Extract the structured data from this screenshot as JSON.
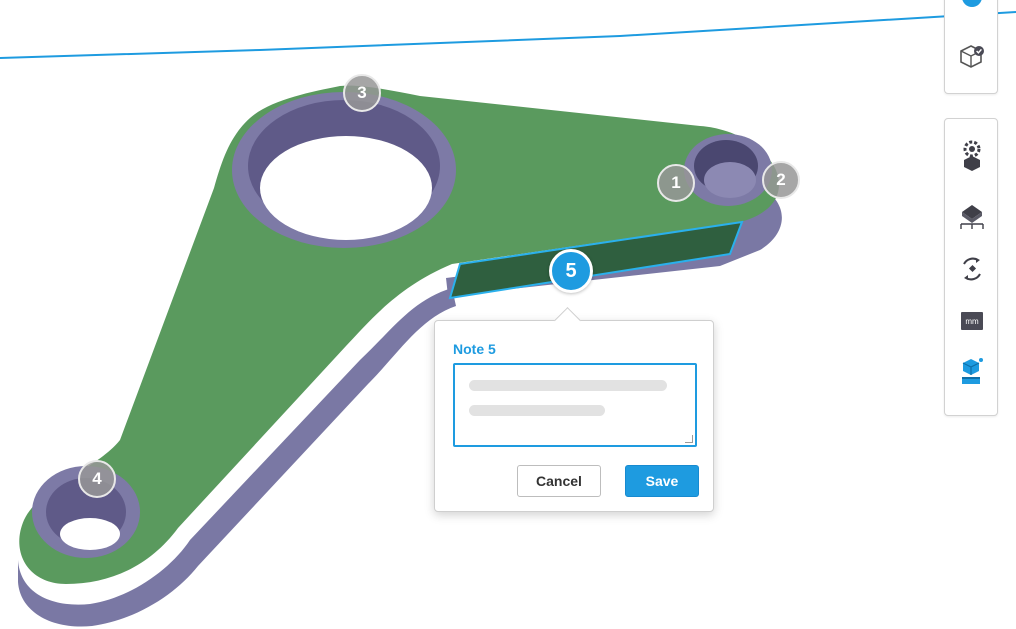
{
  "viewer": {
    "colors": {
      "face": "#5a9a5e",
      "side": "#7d7aa6",
      "accent": "#1e9be0",
      "marker": "#969696"
    },
    "markers": [
      {
        "id": "1",
        "label": "1",
        "state": "default"
      },
      {
        "id": "2",
        "label": "2",
        "state": "default"
      },
      {
        "id": "3",
        "label": "3",
        "state": "default"
      },
      {
        "id": "4",
        "label": "4",
        "state": "default"
      },
      {
        "id": "5",
        "label": "5",
        "state": "active"
      }
    ]
  },
  "note_popup": {
    "title": "Note 5",
    "text_value": "",
    "cancel_label": "Cancel",
    "save_label": "Save"
  },
  "toolbar_view": {
    "items": [
      {
        "icon": "view-cube-icon"
      },
      {
        "icon": "cube-check-icon"
      }
    ]
  },
  "toolbar_tools": {
    "items": [
      {
        "icon": "gear-cube-icon"
      },
      {
        "icon": "measure-surface-icon"
      },
      {
        "icon": "rotate-icon"
      },
      {
        "icon": "units-icon",
        "label": "mm"
      },
      {
        "icon": "explode-part-icon"
      }
    ]
  }
}
